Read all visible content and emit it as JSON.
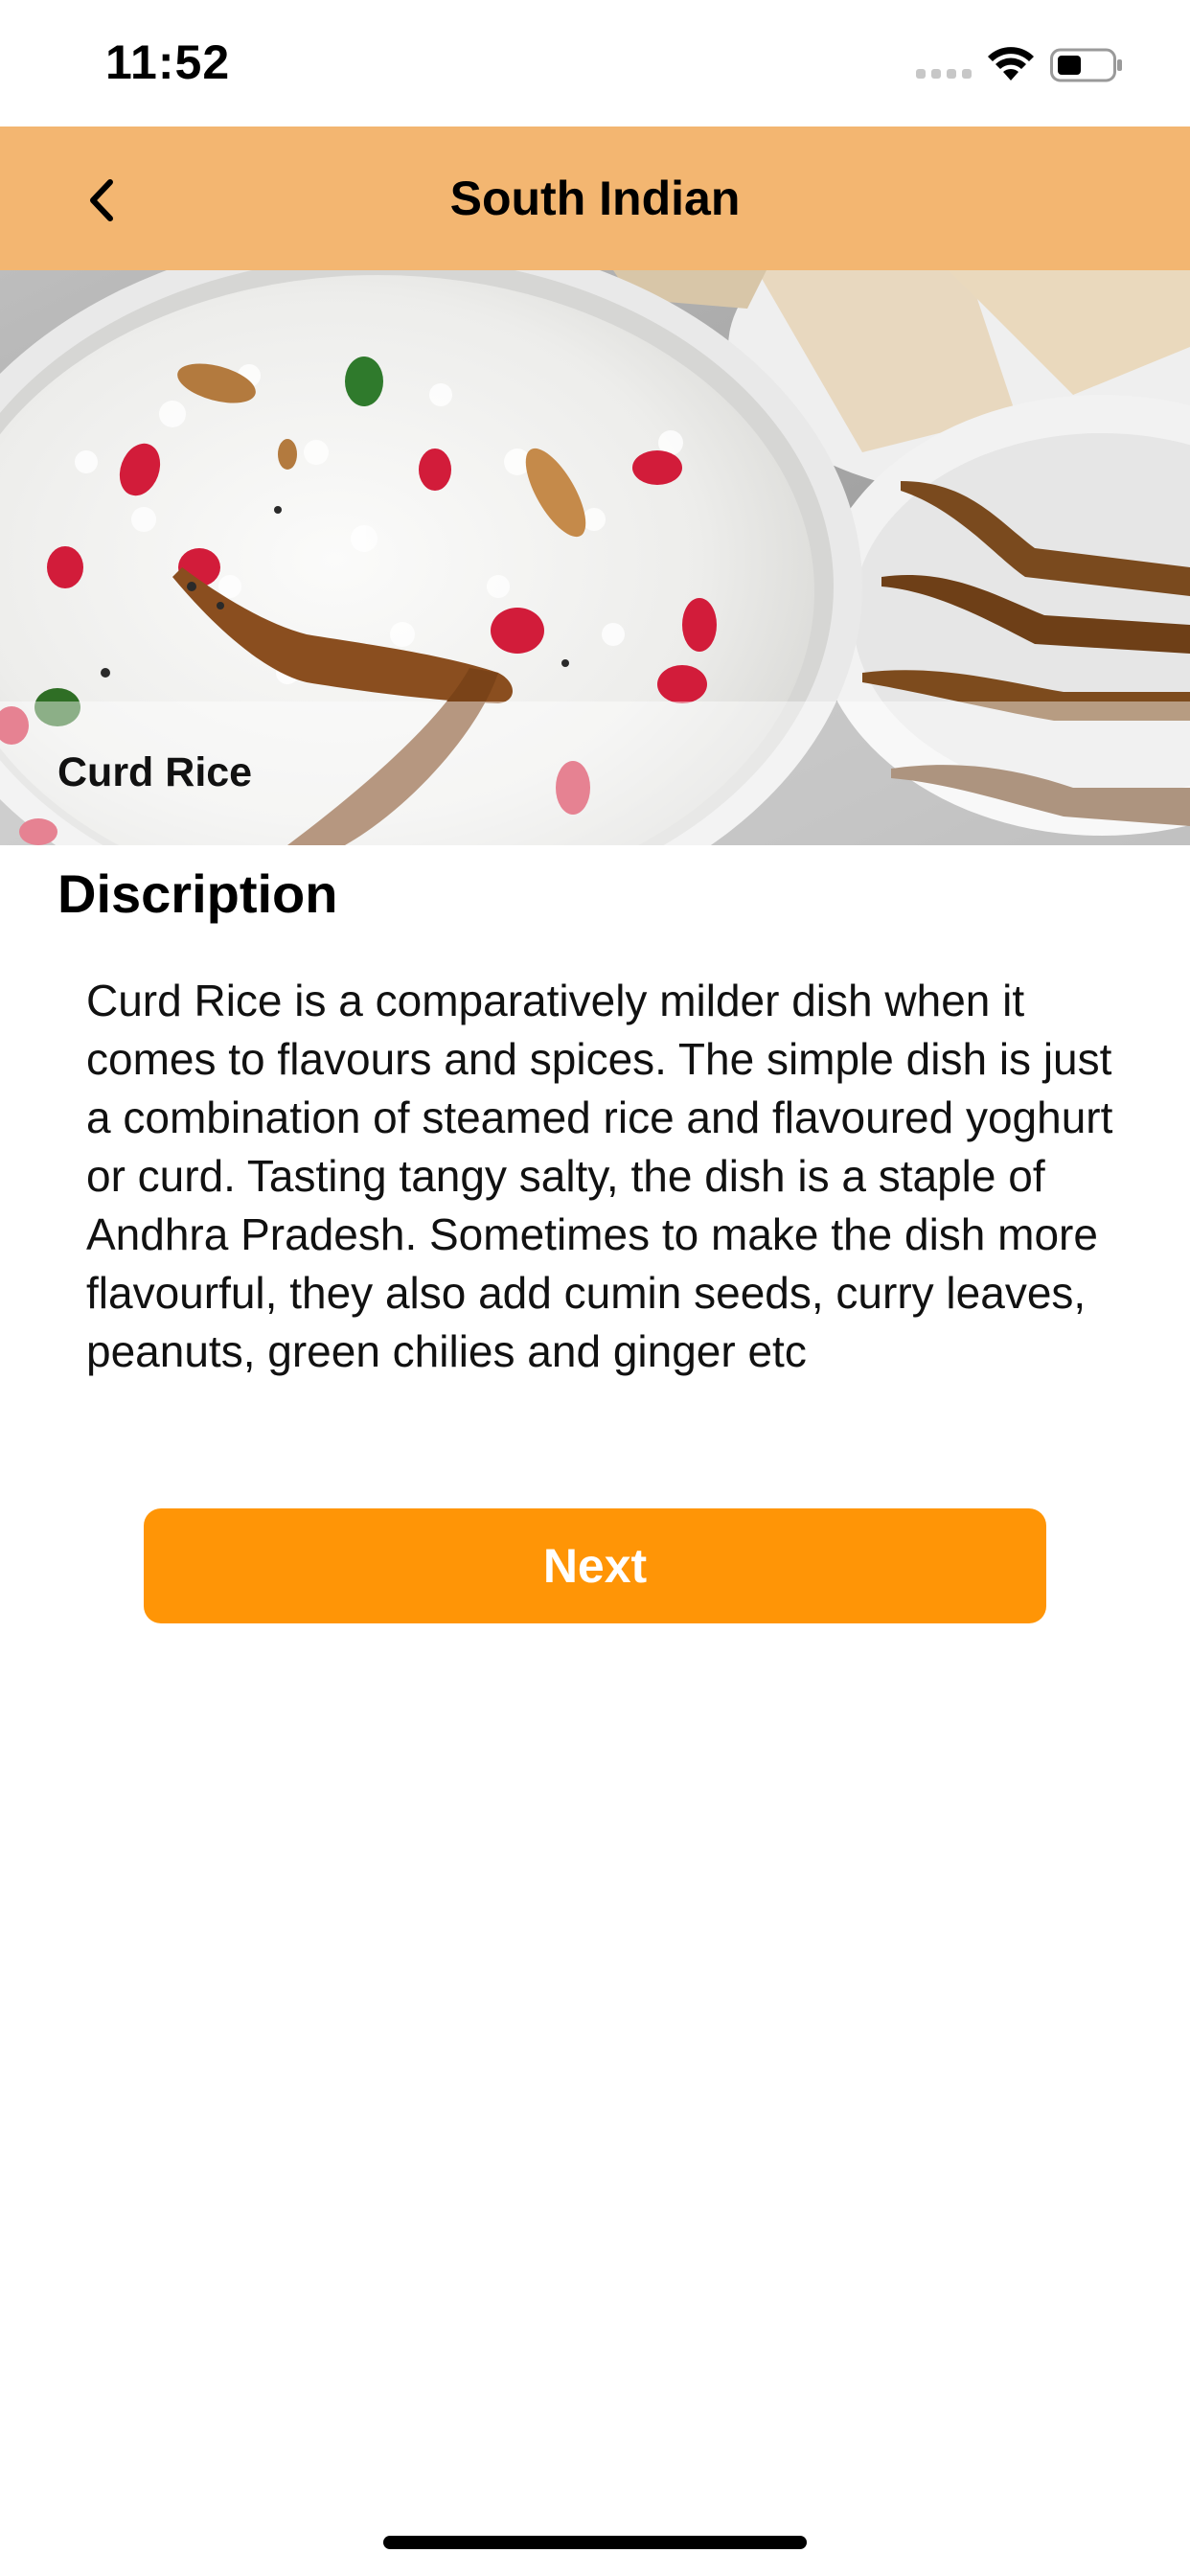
{
  "status_bar": {
    "time": "11:52",
    "icons": [
      "signal-icon",
      "wifi-icon",
      "battery-icon"
    ]
  },
  "nav": {
    "title": "South Indian",
    "back_icon": "chevron-left-icon"
  },
  "hero": {
    "caption": "Curd Rice"
  },
  "content": {
    "heading": "Discription",
    "body": "Curd Rice is a comparatively milder dish when it comes to flavours and spices. The simple dish is just a combination of steamed rice and flavoured yoghurt or curd. Tasting tangy salty, the dish is a staple of Andhra Pradesh. Sometimes to make the dish more flavourful, they also add cumin seeds, curry leaves, peanuts, green chilies and ginger etc"
  },
  "actions": {
    "next_label": "Next"
  },
  "colors": {
    "nav_background": "#f3b671",
    "accent": "#ff9506",
    "text": "#000000"
  }
}
